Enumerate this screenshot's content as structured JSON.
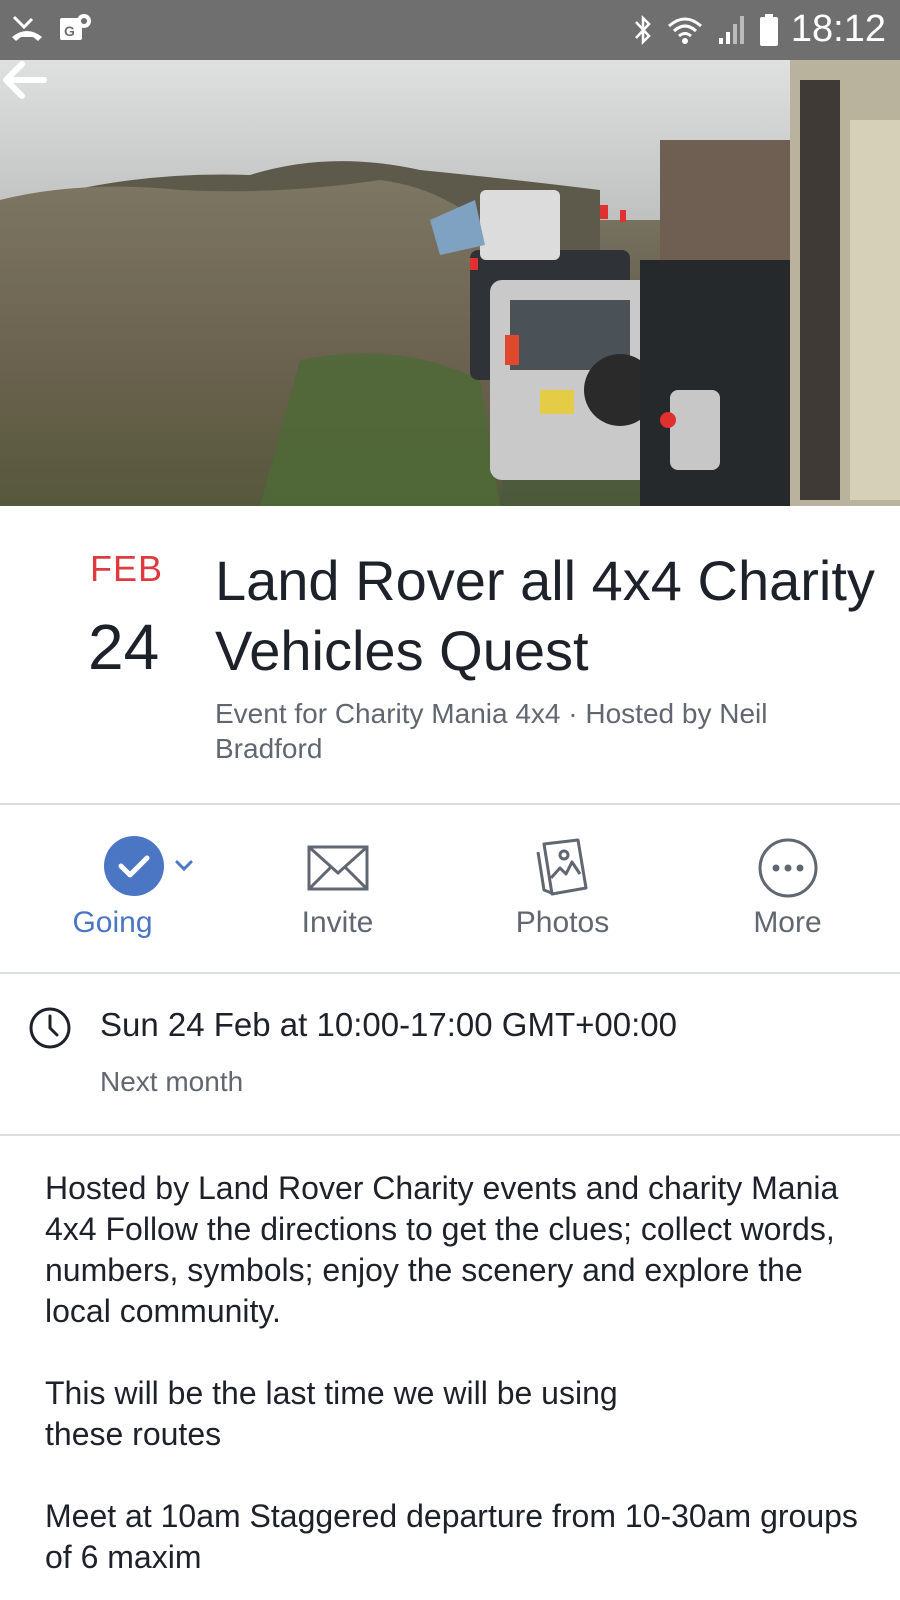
{
  "status_bar": {
    "time": "18:12",
    "left_icons": [
      "missed-call-icon",
      "google-maps-icon"
    ],
    "right_icons": [
      "bluetooth-icon",
      "wifi-icon",
      "signal-icon",
      "battery-icon"
    ]
  },
  "cover": {
    "back_icon": "back-arrow-icon"
  },
  "event": {
    "month": "FEB",
    "day": "24",
    "title": "Land Rover all 4x4 Charity Vehicles Quest",
    "subtitle": "Event for Charity Mania 4x4 · Hosted by Neil Bradford"
  },
  "actions": [
    {
      "label": "Going",
      "icon": "check-circle-icon"
    },
    {
      "label": "Invite",
      "icon": "envelope-icon"
    },
    {
      "label": "Photos",
      "icon": "photos-icon"
    },
    {
      "label": "More",
      "icon": "more-icon"
    }
  ],
  "time": {
    "main": "Sun 24 Feb at 10:00-17:00 GMT+00:00",
    "relative": "Next month"
  },
  "description": {
    "p1": "Hosted by Land Rover Charity events and charity Mania 4x4 Follow the directions to get the clues; collect words, numbers, symbols; enjoy the scenery and explore the local community.",
    "p2": "This will be the last time we will be using these routes",
    "p3": "Meet at 10am Staggered departure from 10-30am groups of 6 maxim"
  },
  "colors": {
    "accent": "#4a76c4",
    "date_month": "#e0393e",
    "secondary_text": "#606770",
    "divider": "#dadde1"
  }
}
